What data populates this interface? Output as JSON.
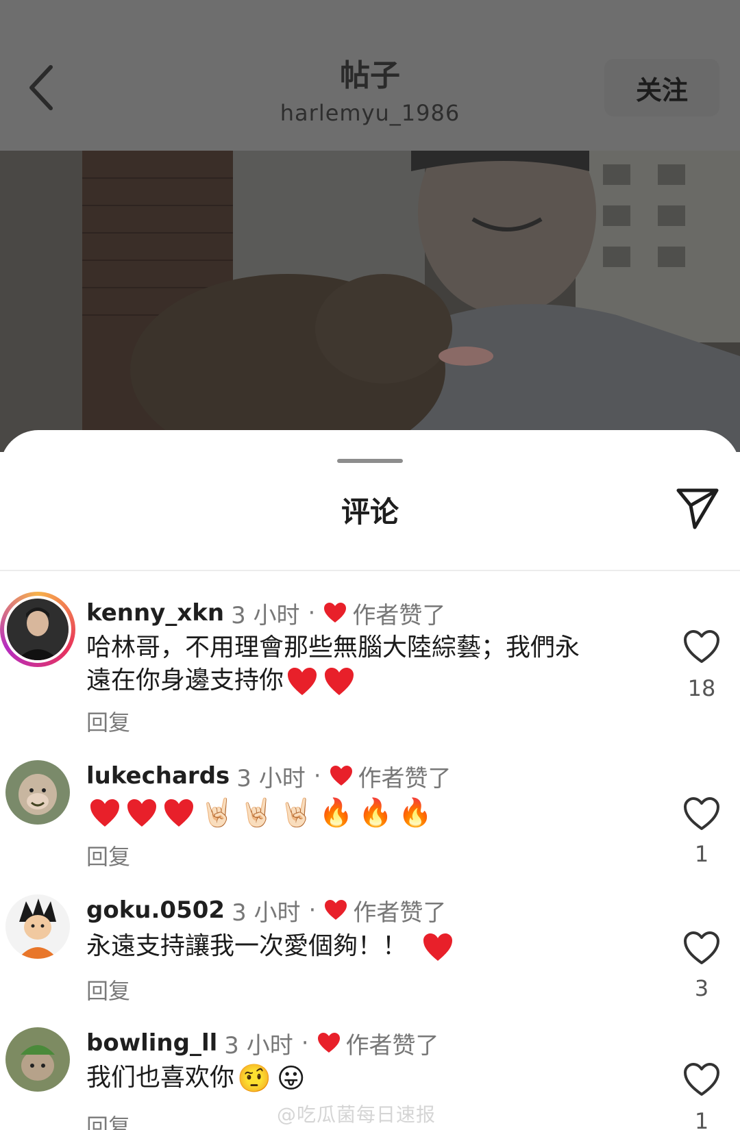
{
  "header": {
    "title": "帖子",
    "username": "harlemyu_1986",
    "follow_label": "关注"
  },
  "sheet": {
    "title": "评论"
  },
  "comments": [
    {
      "username": "kenny_xkn",
      "time": "3 小时",
      "separator": "·",
      "author_liked": "作者赞了",
      "text_line1": "哈林哥，不用理會那些無腦大陸綜藝；我們永",
      "text_line2": "遠在你身邊支持你",
      "reply_label": "回复",
      "like_count": "18"
    },
    {
      "username": "lukechards",
      "time": "3 小时",
      "separator": "·",
      "author_liked": "作者赞了",
      "emoji_rock": "🤘🏻",
      "emoji_fire": "🔥",
      "reply_label": "回复",
      "like_count": "1"
    },
    {
      "username": "goku.0502",
      "time": "3 小时",
      "separator": "·",
      "author_liked": "作者赞了",
      "text": "永遠支持讓我一次愛個夠！！",
      "reply_label": "回复",
      "like_count": "3"
    },
    {
      "username": "bowling_ll",
      "time": "3 小时",
      "separator": "·",
      "author_liked": "作者赞了",
      "text": "我们也喜欢你",
      "emoji_a": "🤨",
      "emoji_b": "😛",
      "reply_label": "回复",
      "like_count": "1"
    }
  ],
  "watermark": "@吃瓜菌每日速报",
  "colors": {
    "heart_red": "#e8202a",
    "dim_overlay": "#6e6e6e"
  },
  "icons": [
    "back-arrow-icon",
    "send-icon",
    "heart-outline-icon",
    "small-heart-icon"
  ]
}
